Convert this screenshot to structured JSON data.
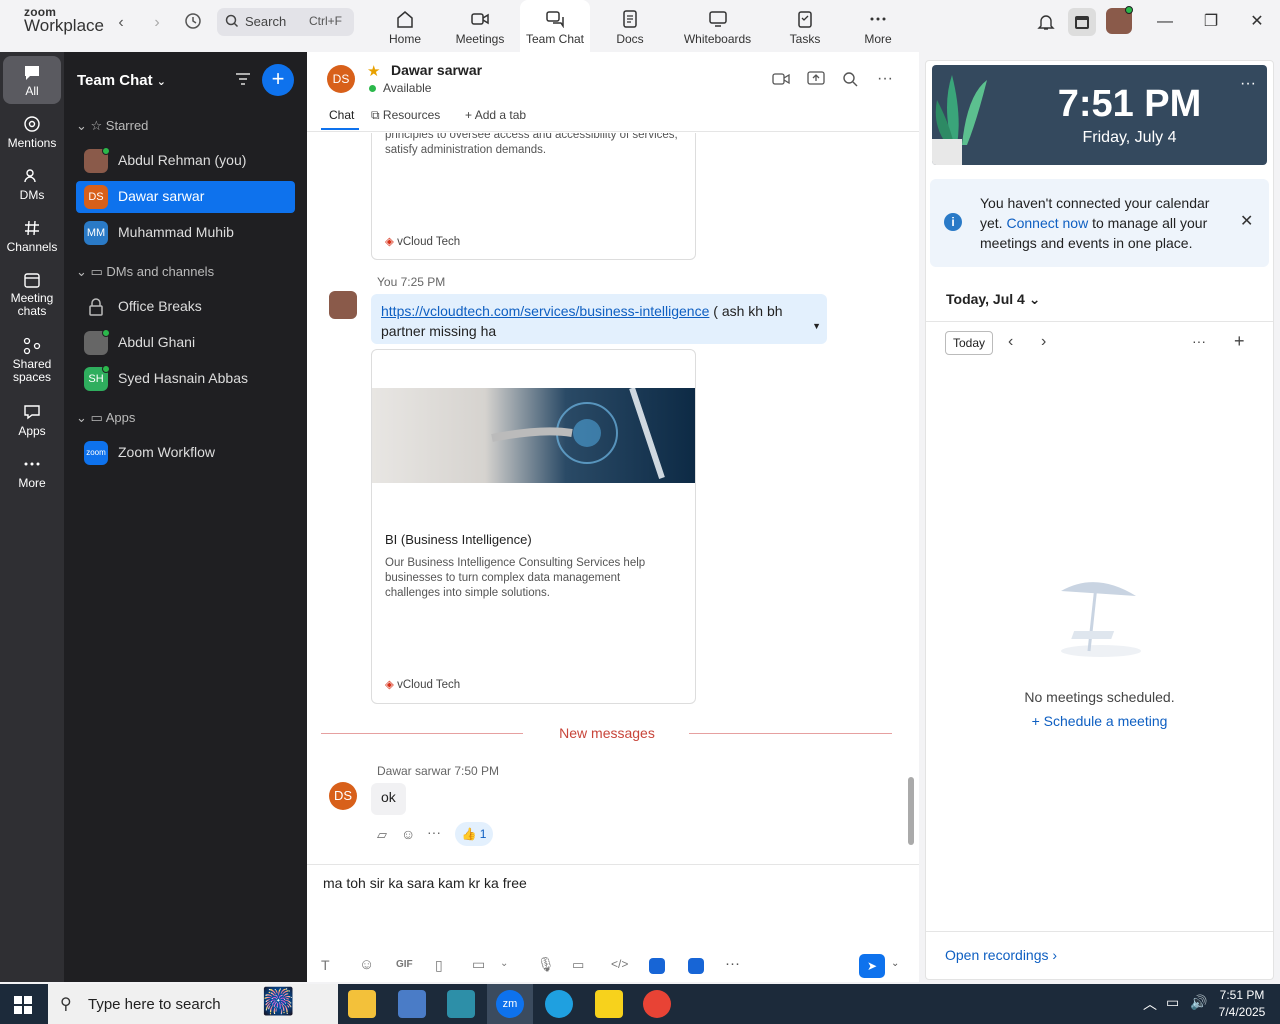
{
  "app": {
    "brand_small": "zoom",
    "brand_big": "Workplace"
  },
  "search": {
    "placeholder": "Search",
    "shortcut": "Ctrl+F"
  },
  "tabs": [
    {
      "label": "Home"
    },
    {
      "label": "Meetings"
    },
    {
      "label": "Team Chat"
    },
    {
      "label": "Docs"
    },
    {
      "label": "Whiteboards"
    },
    {
      "label": "Tasks"
    },
    {
      "label": "More"
    }
  ],
  "rail": [
    {
      "label": "All"
    },
    {
      "label": "Mentions"
    },
    {
      "label": "DMs"
    },
    {
      "label": "Channels"
    },
    {
      "label": "Meeting chats"
    },
    {
      "label": "Shared spaces"
    },
    {
      "label": "Apps"
    },
    {
      "label": "More"
    }
  ],
  "sidebar": {
    "title": "Team Chat",
    "sections": {
      "starred": "Starred",
      "dms": "DMs and channels",
      "apps": "Apps"
    },
    "starred": [
      {
        "label": "Abdul Rehman (you)",
        "initials": ""
      },
      {
        "label": "Dawar sarwar",
        "initials": "DS"
      },
      {
        "label": "Muhammad Muhib",
        "initials": "MM"
      }
    ],
    "dms": [
      {
        "label": "Office Breaks"
      },
      {
        "label": "Abdul Ghani"
      },
      {
        "label": "Syed Hasnain Abbas",
        "initials": "SH"
      }
    ],
    "apps": [
      {
        "label": "Zoom Workflow",
        "initials": "zoom"
      }
    ]
  },
  "chat": {
    "contact_initials": "DS",
    "contact_name": "Dawar sarwar",
    "status": "Available",
    "tabs": {
      "chat": "Chat",
      "resources": "Resources",
      "add": "Add a tab"
    },
    "card1": {
      "desc": "principles to oversee access and accessibility of services, satisfy administration demands.",
      "source": "vCloud Tech"
    },
    "msg2": {
      "sender": "You",
      "time": "7:25 PM",
      "link": "https://vcloudtech.com/services/business-intelligence",
      "text": " ( ash kh bh partner missing ha"
    },
    "card2": {
      "title": "BI  (Business Intelligence)",
      "desc": "Our Business Intelligence Consulting Services help businesses to turn complex data management challenges into simple solutions.",
      "source": "vCloud Tech"
    },
    "divider": "New messages",
    "msg3": {
      "initials": "DS",
      "sender": "Dawar sarwar",
      "time": "7:50 PM",
      "text": "ok",
      "reaction": "👍 1"
    },
    "composer_text": "ma toh sir ka sara kam kr ka free ",
    "gif": "GIF"
  },
  "right": {
    "clock_time": "7:51 PM",
    "clock_date": "Friday, July 4",
    "banner_pre": "You haven't connected your calendar yet. ",
    "banner_link": "Connect now",
    "banner_post": " to manage all your meetings and events in one place.",
    "date_heading": "Today, Jul 4",
    "today_btn": "Today",
    "empty": "No meetings scheduled.",
    "schedule": "Schedule a meeting",
    "recordings": "Open recordings"
  },
  "taskbar": {
    "search_placeholder": "Type here to search",
    "time": "7:51 PM",
    "date": "7/4/2025"
  },
  "colors": {
    "accent": "#0e72ed",
    "rail": "#2f2f33",
    "sidebar": "#1f1f22",
    "clock_bg": "#34495e"
  }
}
